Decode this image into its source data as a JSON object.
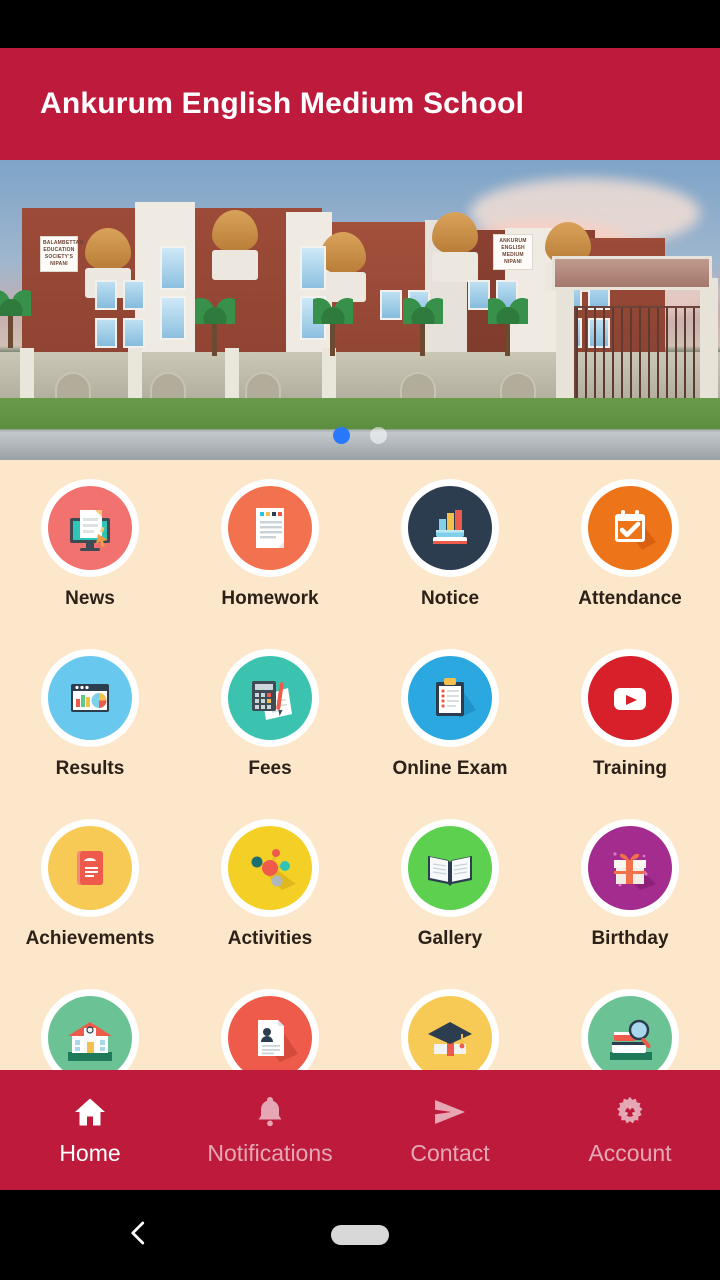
{
  "header": {
    "title": "Ankurum English Medium School",
    "background_color": "#BE1A3C"
  },
  "banner": {
    "alt": "school-building-photo",
    "sign_left": "BALAMBETTAN EDUCATION SOCIETY'S NIPANI",
    "sign_right": "ANKURUM ENGLISH MEDIUM NIPANI",
    "carousel": {
      "total_dots": 2,
      "active_index": 0,
      "active_color": "#2979FF",
      "inactive_color": "#FFFFFF"
    }
  },
  "grid": {
    "background_color": "#FDE7CA",
    "label_color": "#2C2118",
    "items": [
      {
        "label": "News",
        "icon": "news-monitor-icon",
        "disc_color": "#F2726F"
      },
      {
        "label": "Homework",
        "icon": "homework-document-icon",
        "disc_color": "#F2714E"
      },
      {
        "label": "Notice",
        "icon": "notice-books-chart-icon",
        "disc_color": "#2B3D4F"
      },
      {
        "label": "Attendance",
        "icon": "attendance-calendar-icon",
        "disc_color": "#EE7419"
      },
      {
        "label": "Results",
        "icon": "results-chart-window-icon",
        "disc_color": "#69C8EE"
      },
      {
        "label": "Fees",
        "icon": "fees-calculator-icon",
        "disc_color": "#3BC3B0"
      },
      {
        "label": "Online Exam",
        "icon": "online-exam-clipboard-icon",
        "disc_color": "#2BA8E0"
      },
      {
        "label": "Training",
        "icon": "training-video-play-icon",
        "disc_color": "#D7202A"
      },
      {
        "label": "Achievements",
        "icon": "achievements-certificate-icon",
        "disc_color": "#F6CA54"
      },
      {
        "label": "Activities",
        "icon": "activities-molecule-icon",
        "disc_color": "#F4D026"
      },
      {
        "label": "Gallery",
        "icon": "gallery-open-book-icon",
        "disc_color": "#5DD14F"
      },
      {
        "label": "Birthday",
        "icon": "birthday-gift-icon",
        "disc_color": "#A32C8E"
      },
      {
        "label": "",
        "icon": "school-building-icon",
        "disc_color": "#6BC395"
      },
      {
        "label": "",
        "icon": "profile-resume-icon",
        "disc_color": "#EE5B4B"
      },
      {
        "label": "",
        "icon": "graduation-cap-icon",
        "disc_color": "#F6CA54"
      },
      {
        "label": "",
        "icon": "books-search-icon",
        "disc_color": "#6BC395"
      }
    ]
  },
  "bottom_nav": {
    "background_color": "#BE1A3C",
    "active_index": 0,
    "items": [
      {
        "label": "Home",
        "icon": "home-icon"
      },
      {
        "label": "Notifications",
        "icon": "bell-icon"
      },
      {
        "label": "Contact",
        "icon": "send-icon"
      },
      {
        "label": "Account",
        "icon": "gear-icon"
      }
    ]
  },
  "system_nav": {
    "back": "back-chevron-icon",
    "home_pill": "home-pill-indicator"
  }
}
